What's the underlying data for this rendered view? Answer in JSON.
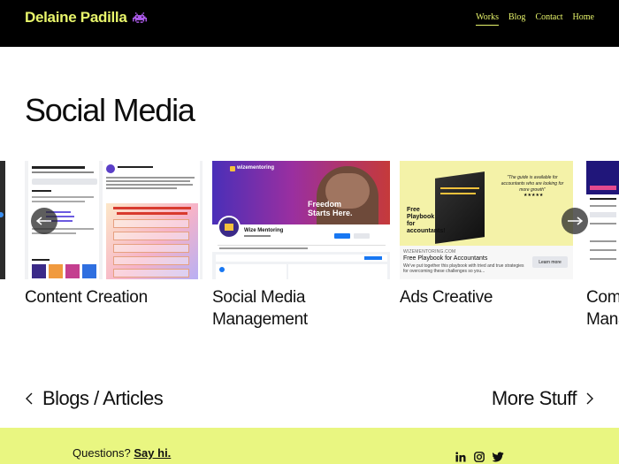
{
  "header": {
    "brand": "Delaine Padilla",
    "nav": [
      {
        "label": "Works",
        "active": true
      },
      {
        "label": "Blog",
        "active": false
      },
      {
        "label": "Contact",
        "active": false
      },
      {
        "label": "Home",
        "active": false
      }
    ]
  },
  "page": {
    "title": "Social Media"
  },
  "carousel": {
    "slides": [
      {
        "caption": "Content Creation"
      },
      {
        "caption": "Social Media Management"
      },
      {
        "caption": "Ads Creative"
      },
      {
        "caption": "Community Management"
      }
    ],
    "thumb_text": {
      "wize": "wizementoring",
      "freedom": "Freedom Starts Here.",
      "page_name": "Wize Mentoring",
      "ad_domain": "WIZEMENTORING.COM",
      "ad_title": "Free Playbook for Accountants",
      "ad_desc": "We've put together this playbook with tried and true strategies for overcoming these challenges so you...",
      "ad_cta": "Learn more",
      "ad_book": "Free Playbook for accountants!",
      "ad_quote": "\"The guide is available for accountants who are looking for more growth\""
    }
  },
  "lower_nav": {
    "left": "Blogs / Articles",
    "right": "More Stuff"
  },
  "footer": {
    "question": "Questions?",
    "say_hi": "Say hi."
  },
  "colors": {
    "accent": "#e8f56b",
    "footer_bg": "#e9f681",
    "header_bg": "#000000"
  }
}
